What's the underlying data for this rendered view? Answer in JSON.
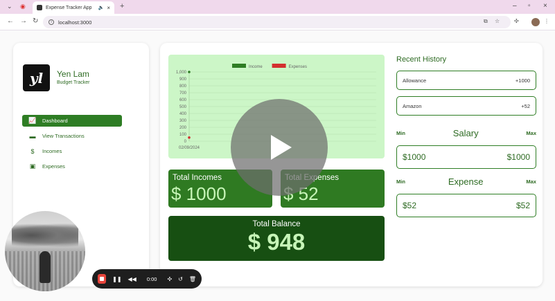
{
  "browser": {
    "tab_title": "Expense Tracker App",
    "url": "localhost:3000"
  },
  "sidebar": {
    "user_name": "Yen Lam",
    "user_role": "Budget Tracker",
    "logo_text": "yl",
    "items": [
      {
        "label": "Dashboard",
        "icon": "trend-chart-icon",
        "active": true
      },
      {
        "label": "View Transactions",
        "icon": "credit-card-icon",
        "active": false
      },
      {
        "label": "Incomes",
        "icon": "money-bag-icon",
        "active": false
      },
      {
        "label": "Expenses",
        "icon": "cash-icon",
        "active": false
      }
    ]
  },
  "chart_data": {
    "type": "line",
    "categories": [
      "02/09/2024"
    ],
    "series": [
      {
        "name": "Income",
        "values": [
          1000
        ],
        "color": "#2e7d24"
      },
      {
        "name": "Expenses",
        "values": [
          52
        ],
        "color": "#d32f2f"
      }
    ],
    "yticks": [
      "1,000",
      "900",
      "800",
      "700",
      "600",
      "500",
      "400",
      "300",
      "200",
      "100",
      "0"
    ],
    "ylim": [
      0,
      1000
    ],
    "grid": true,
    "legend": "top-center"
  },
  "stats": {
    "incomes_label": "Total Incomes",
    "incomes_value": "$ 1000",
    "expenses_label": "Total Expenses",
    "expenses_value": "$ 52",
    "balance_label": "Total Balance",
    "balance_value": "$ 948"
  },
  "history": {
    "title": "Recent History",
    "items": [
      {
        "name": "Allowance",
        "amount": "+1000"
      },
      {
        "name": "Amazon",
        "amount": "+52"
      }
    ]
  },
  "salary": {
    "title": "Salary",
    "min_label": "Min",
    "max_label": "Max",
    "min_value": "$1000",
    "max_value": "$1000"
  },
  "expense": {
    "title": "Expense",
    "min_label": "Min",
    "max_label": "Max",
    "min_value": "$52",
    "max_value": "$52"
  },
  "recorder": {
    "time": "0:00"
  },
  "colors": {
    "accent": "#2e7d24",
    "chart_bg": "#ccf6c7",
    "balance_bg": "#174f12",
    "stop": "#e8453c"
  }
}
